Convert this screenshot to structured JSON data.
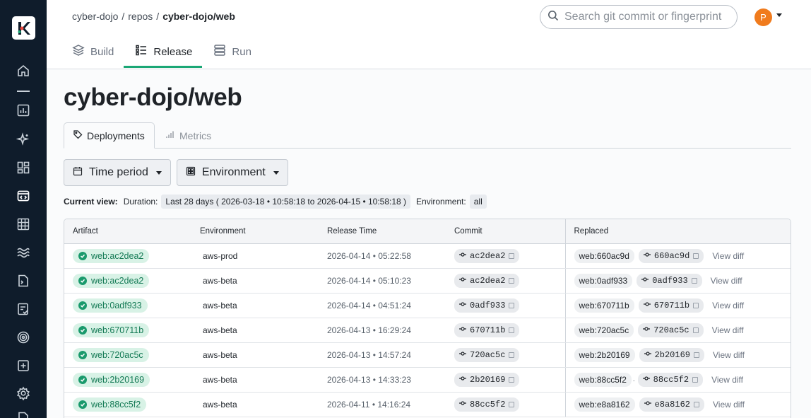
{
  "colors": {
    "sidebar_bg": "#0f1c2b",
    "accent": "#1aa775",
    "avatar_bg": "#f07b1d",
    "pill_green_bg": "#d8f2e6",
    "pill_green_fg": "#147a55"
  },
  "sidebar": {
    "logo_icon": "kosli-logo-icon",
    "items": [
      {
        "icon": "home-icon"
      },
      {
        "icon": "bar-chart-icon"
      },
      {
        "icon": "sparkle-icon"
      },
      {
        "icon": "dashboard-icon"
      },
      {
        "icon": "code-repo-icon"
      },
      {
        "icon": "grid-icon"
      },
      {
        "icon": "waves-icon"
      },
      {
        "icon": "terminal-file-icon"
      },
      {
        "icon": "checklist-icon"
      },
      {
        "icon": "target-icon"
      },
      {
        "icon": "plus-square-icon"
      },
      {
        "icon": "settings-icon"
      }
    ]
  },
  "header": {
    "breadcrumb": {
      "org": "cyber-dojo",
      "section": "repos",
      "current": "cyber-dojo/web",
      "separator": "/"
    },
    "search": {
      "placeholder": "Search git commit or fingerprint"
    },
    "avatar_initial": "P",
    "tabs": [
      {
        "label": "Build",
        "icon": "layers-icon",
        "active": false
      },
      {
        "label": "Release",
        "icon": "list-icon",
        "active": true
      },
      {
        "label": "Run",
        "icon": "server-icon",
        "active": false
      }
    ]
  },
  "main": {
    "title": "cyber-dojo/web",
    "sub_tabs": [
      {
        "label": "Deployments",
        "icon": "tag-icon",
        "active": true
      },
      {
        "label": "Metrics",
        "icon": "metrics-icon",
        "active": false
      }
    ],
    "filters": {
      "time_period": "Time period",
      "environment": "Environment"
    },
    "current_view": {
      "label": "Current view:",
      "duration_key": "Duration:",
      "duration_val": "Last 28 days ( 2026-03-18 • 10:58:18 to 2026-04-15 • 10:58:18 )",
      "environment_key": "Environment:",
      "environment_val": "all"
    },
    "table": {
      "headers": {
        "artifact": "Artifact",
        "environment": "Environment",
        "release_time": "Release Time",
        "commit": "Commit",
        "replaced": "Replaced"
      },
      "view_diff_label": "View diff",
      "rows": [
        {
          "artifact": "web:ac2dea2",
          "environment": "aws-prod",
          "release_time": "2026-04-14 • 05:22:58",
          "commit": "ac2dea2",
          "replaced_artifact": "web:660ac9d",
          "replaced_commit": "660ac9d",
          "dot": ""
        },
        {
          "artifact": "web:ac2dea2",
          "environment": "aws-beta",
          "release_time": "2026-04-14 • 05:10:23",
          "commit": "ac2dea2",
          "replaced_artifact": "web:0adf933",
          "replaced_commit": "0adf933",
          "dot": ""
        },
        {
          "artifact": "web:0adf933",
          "environment": "aws-beta",
          "release_time": "2026-04-14 • 04:51:24",
          "commit": "0adf933",
          "replaced_artifact": "web:670711b",
          "replaced_commit": "670711b",
          "dot": ""
        },
        {
          "artifact": "web:670711b",
          "environment": "aws-beta",
          "release_time": "2026-04-13 • 16:29:24",
          "commit": "670711b",
          "replaced_artifact": "web:720ac5c",
          "replaced_commit": "720ac5c",
          "dot": ""
        },
        {
          "artifact": "web:720ac5c",
          "environment": "aws-beta",
          "release_time": "2026-04-13 • 14:57:24",
          "commit": "720ac5c",
          "replaced_artifact": "web:2b20169",
          "replaced_commit": "2b20169",
          "dot": ""
        },
        {
          "artifact": "web:2b20169",
          "environment": "aws-beta",
          "release_time": "2026-04-13 • 14:33:23",
          "commit": "2b20169",
          "replaced_artifact": "web:88cc5f2",
          "replaced_commit": "88cc5f2",
          "dot": "."
        },
        {
          "artifact": "web:88cc5f2",
          "environment": "aws-beta",
          "release_time": "2026-04-11 • 14:16:24",
          "commit": "88cc5f2",
          "replaced_artifact": "web:e8a8162",
          "replaced_commit": "e8a8162",
          "dot": ""
        }
      ]
    }
  }
}
